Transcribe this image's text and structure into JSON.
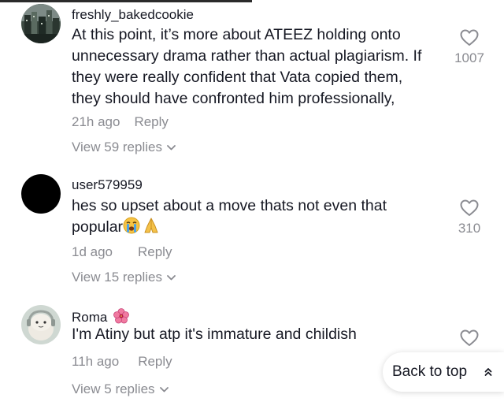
{
  "comments": [
    {
      "username": "freshly_bakedcookie",
      "lines": [
        "At this point, it’s more about ATEEZ holding onto",
        "unnecessary drama rather than actual plagiarism. If",
        "they were really confident that Vata copied them,",
        "they should have confronted him professionally,"
      ],
      "time": "21h ago",
      "reply_label": "Reply",
      "view_replies": "View 59 replies",
      "likes": "1007"
    },
    {
      "username": "user579959",
      "lines": [
        "hes so upset about a move thats not even that",
        "popular"
      ],
      "time": "1d ago",
      "reply_label": "Reply",
      "view_replies": "View 15 replies",
      "likes": "310"
    },
    {
      "username": "Roma",
      "lines": [
        "I'm Atiny but atp it's immature and childish"
      ],
      "time": "11h ago",
      "reply_label": "Reply",
      "view_replies": "View 5 replies"
    }
  ],
  "back_to_top": "Back to top",
  "icons": {
    "like": "heart-outline-icon",
    "expand": "chevron-down-icon",
    "back_to_top": "double-chevron-up-icon",
    "emojis": [
      "loudly-crying-face-emoji",
      "folded-hands-emoji",
      "hibiscus-emoji"
    ]
  },
  "colors": {
    "text": "#161823",
    "muted": "#8a8b91",
    "background": "#ffffff"
  }
}
